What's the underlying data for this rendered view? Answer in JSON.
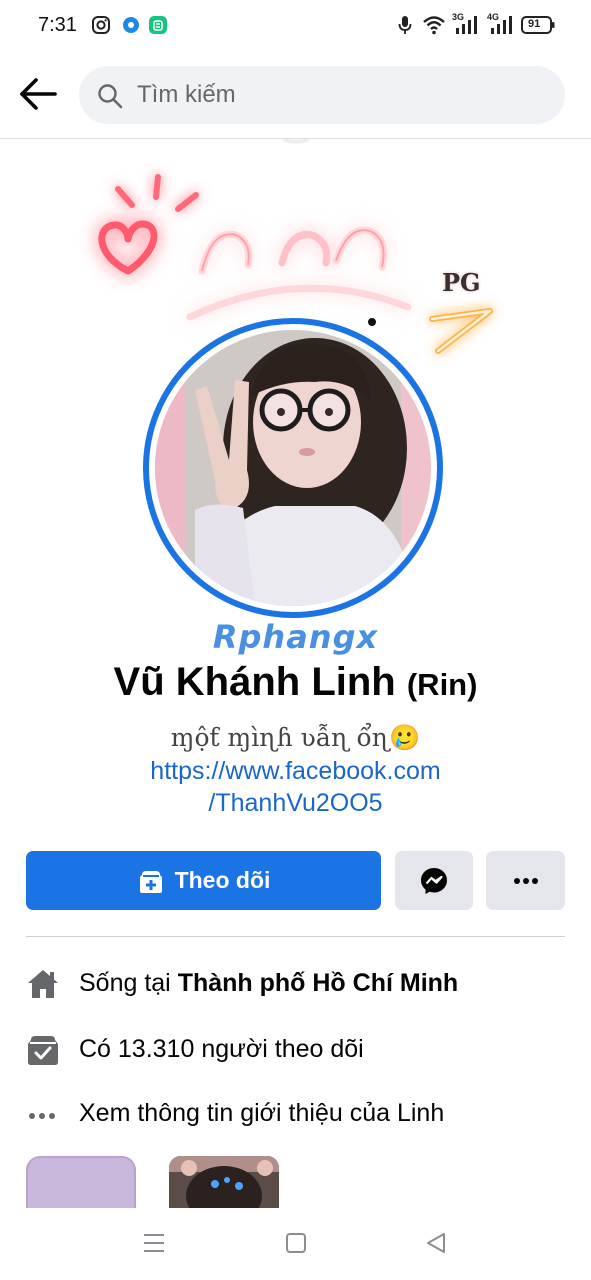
{
  "status_bar": {
    "time": "7:31",
    "left_icons": [
      "instagram-icon",
      "messenger-lite-icon",
      "android-app-icon"
    ],
    "right_icons": [
      "mic-icon",
      "wifi-icon",
      "signal-3g-icon",
      "signal-4g-icon",
      "battery-icon"
    ],
    "net_3g": "3G",
    "net_4g": "4G",
    "battery": "91"
  },
  "header": {
    "back_icon": "arrow-left-icon",
    "search_placeholder": "Tìm kiếm"
  },
  "cover": {
    "badge_text": "PG",
    "watermark": "Rphangx"
  },
  "profile": {
    "name": "Vũ Khánh Linh",
    "nickname": "(Rin)",
    "bio": "ɱộƭ ɱìɳɦ ʋẫɳ ổɳ🥲",
    "link_line1": "https://www.facebook.com",
    "link_line2": "/ThanhVu2OO5"
  },
  "actions": {
    "follow_label": "Theo dõi",
    "follow_icon": "follow-plus-icon",
    "message_icon": "messenger-icon",
    "more_icon": "more-dots-icon"
  },
  "intro": {
    "lives_prefix": "Sống tại ",
    "lives_city": "Thành phố Hồ Chí Minh",
    "followers_text": "Có 13.310 người theo dõi",
    "about_text": "Xem thông tin giới thiệu của Linh"
  },
  "colors": {
    "accent": "#1b74e4",
    "link": "#1a67c9",
    "button_gray": "#e4e6eb",
    "search_bg": "#f0f2f5"
  },
  "nav": [
    "menu-icon",
    "home-square-icon",
    "back-triangle-icon"
  ]
}
